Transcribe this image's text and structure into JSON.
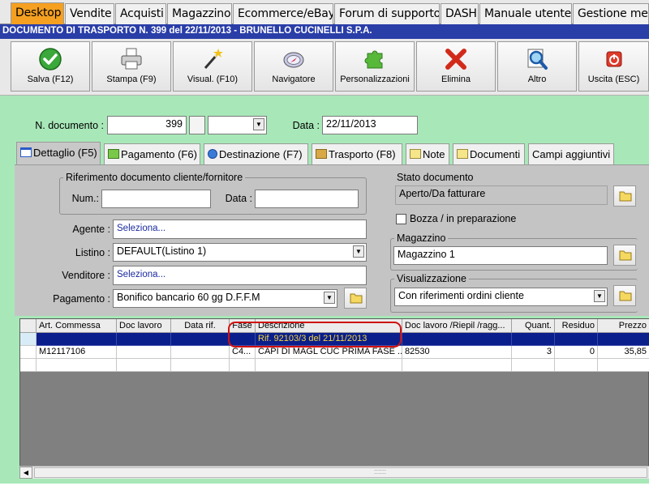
{
  "top_tabs": [
    "Desktop",
    "Vendite",
    "Acquisti",
    "Magazzino",
    "Ecommerce/eBay",
    "Forum di supporto",
    "DASH",
    "Manuale utente",
    "Gestione mess"
  ],
  "title": "DOCUMENTO DI TRASPORTO N. 399 del 22/11/2013 - BRUNELLO CUCINELLI S.P.A.",
  "toolbar": {
    "salva": "Salva (F12)",
    "stampa": "Stampa (F9)",
    "visual": "Visual. (F10)",
    "navigatore": "Navigatore",
    "personalizzazioni": "Personalizzazioni",
    "elimina": "Elimina",
    "altro": "Altro",
    "uscita": "Uscita (ESC)"
  },
  "header_fields": {
    "numero_label": "N. documento :",
    "numero_value": "399",
    "data_label": "Data :",
    "data_value": "22/11/2013"
  },
  "inner_tabs": [
    "Dettaglio (F5)",
    "Pagamento (F6)",
    "Destinazione (F7)",
    "Trasporto (F8)",
    "Note",
    "Documenti",
    "Campi aggiuntivi"
  ],
  "riferimento": {
    "title": "Riferimento documento cliente/fornitore",
    "num_label": "Num.:",
    "num_value": "",
    "data_label": "Data :",
    "data_value": ""
  },
  "left_form": {
    "agente_label": "Agente :",
    "agente_value": "Seleziona...",
    "listino_label": "Listino :",
    "listino_value": "DEFAULT(Listino 1)",
    "venditore_label": "Venditore :",
    "venditore_value": "Seleziona...",
    "pagamento_label": "Pagamento :",
    "pagamento_value": "Bonifico bancario 60 gg D.F.F.M"
  },
  "stato": {
    "title": "Stato documento",
    "value": "Aperto/Da fatturare",
    "bozza_label": "Bozza / in preparazione"
  },
  "magazzino": {
    "title": "Magazzino",
    "value": "Magazzino 1"
  },
  "visualizzazione": {
    "title": "Visualizzazione",
    "value": "Con riferimenti ordini cliente"
  },
  "grid": {
    "columns": [
      "Art. Commessa",
      "Doc lavoro",
      "Data rif.",
      "Fase",
      "Descrizione",
      "Doc lavoro /Riepil /ragg...",
      "Quant.",
      "Residuo",
      "Prezzo"
    ],
    "rows": [
      [
        "",
        "",
        "",
        "",
        "Rif. 92103/3 del 21/11/2013",
        "",
        "",
        "",
        ""
      ],
      [
        "M12117106",
        "",
        "",
        "C4...",
        "CAPI DI MAGL CUC PRIMA FASE ...",
        "82530",
        "3",
        "0",
        "35,85"
      ]
    ],
    "scroll_grip": "::::::"
  },
  "colors": {
    "background": "#a8e8b8",
    "active_tab": "#f5a021",
    "title_strip": "#2a3ea8",
    "selected_row": "#0a1f8c",
    "selected_text": "#f4d23c",
    "highlight_ring": "#d01010"
  }
}
